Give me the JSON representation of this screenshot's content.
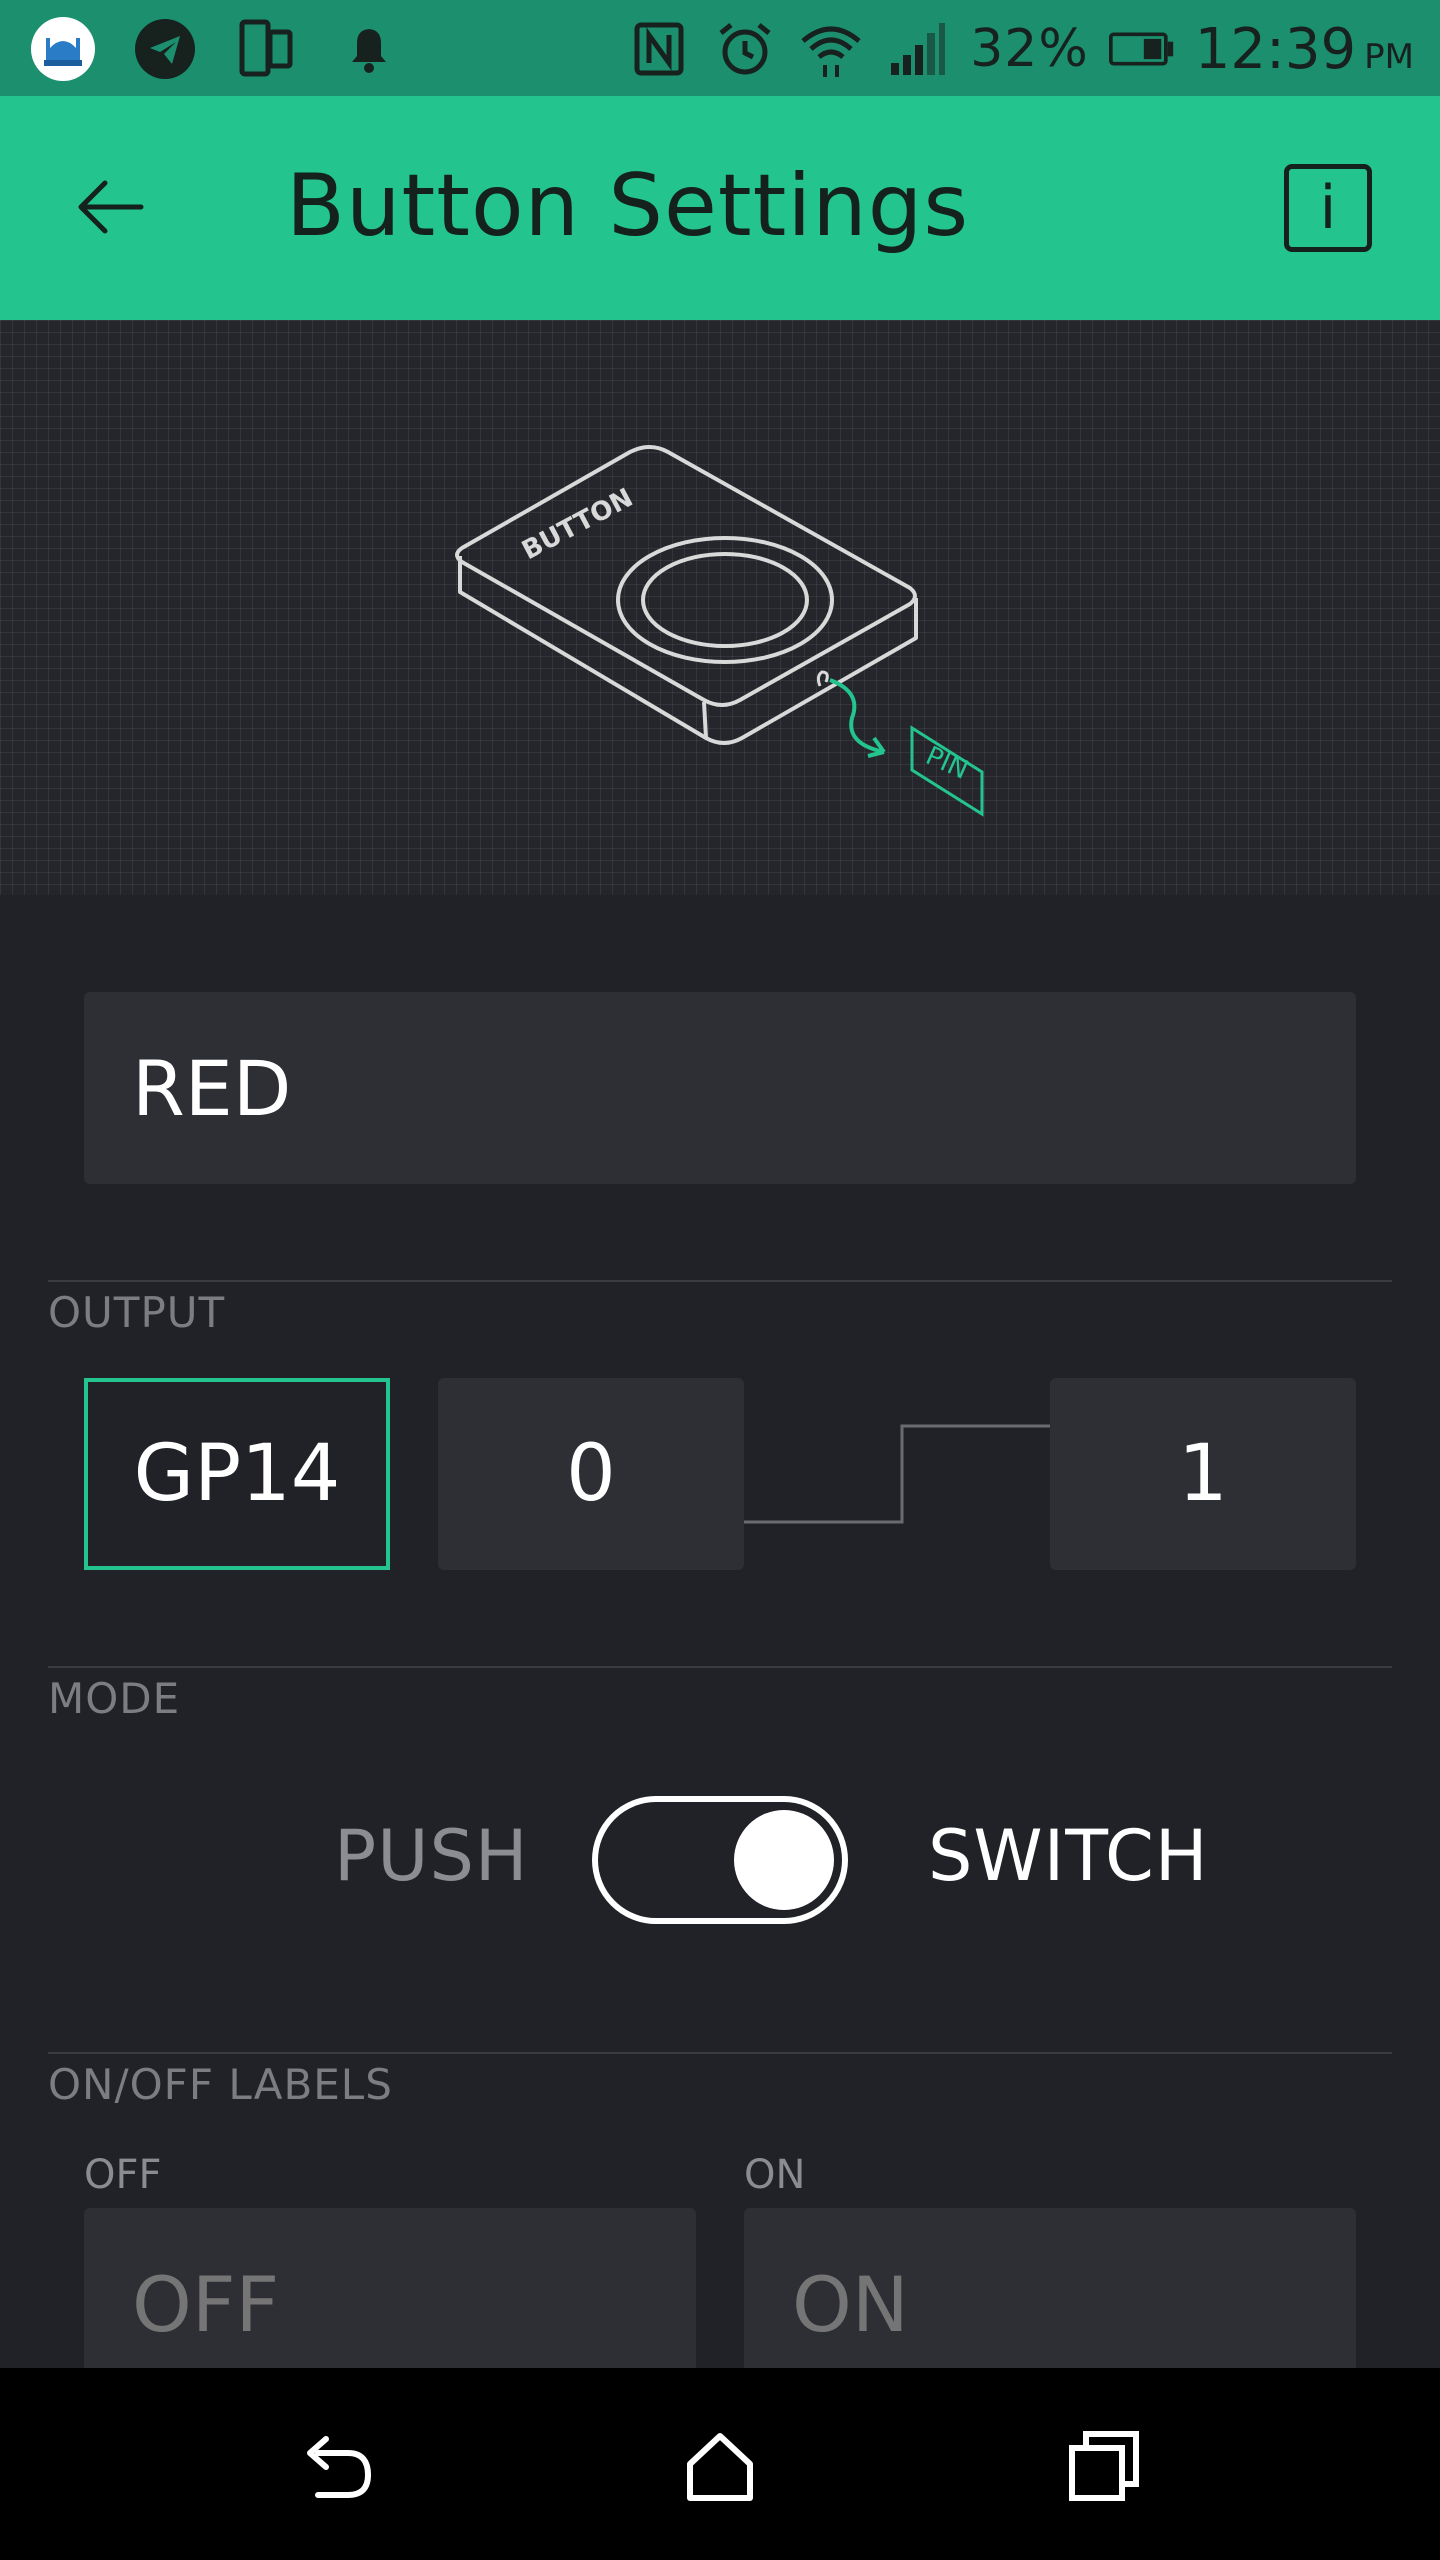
{
  "status_bar": {
    "left_icons": [
      "app-mosque-icon",
      "telegram-icon",
      "phone-sync-icon",
      "notification-bell-icon"
    ],
    "right_icons": [
      "nfc-icon",
      "alarm-icon",
      "wifi-icon",
      "signal-icon"
    ],
    "battery_percent": "32%",
    "time": "12:39",
    "ampm": "PM"
  },
  "app_bar": {
    "title": "Button Settings",
    "info_label": "i"
  },
  "illustration": {
    "device_label": "BUTTON",
    "pin_label": "PIN",
    "accent_color": "#23c48e"
  },
  "name_field": {
    "value": "RED"
  },
  "output": {
    "section_label": "OUTPUT",
    "pin": "GP14",
    "low_value": "0",
    "high_value": "1"
  },
  "mode": {
    "section_label": "MODE",
    "left_option": "PUSH",
    "right_option": "SWITCH",
    "selected": "SWITCH"
  },
  "labels": {
    "section_label": "ON/OFF LABELS",
    "off_label": "OFF",
    "on_label": "ON",
    "off_value": "OFF",
    "on_value": "ON"
  },
  "nav_bar": {
    "buttons": [
      "back-icon",
      "home-icon",
      "recents-icon"
    ]
  },
  "colors": {
    "accent": "#23c48e",
    "background": "#212227",
    "field": "#2e2f35"
  }
}
